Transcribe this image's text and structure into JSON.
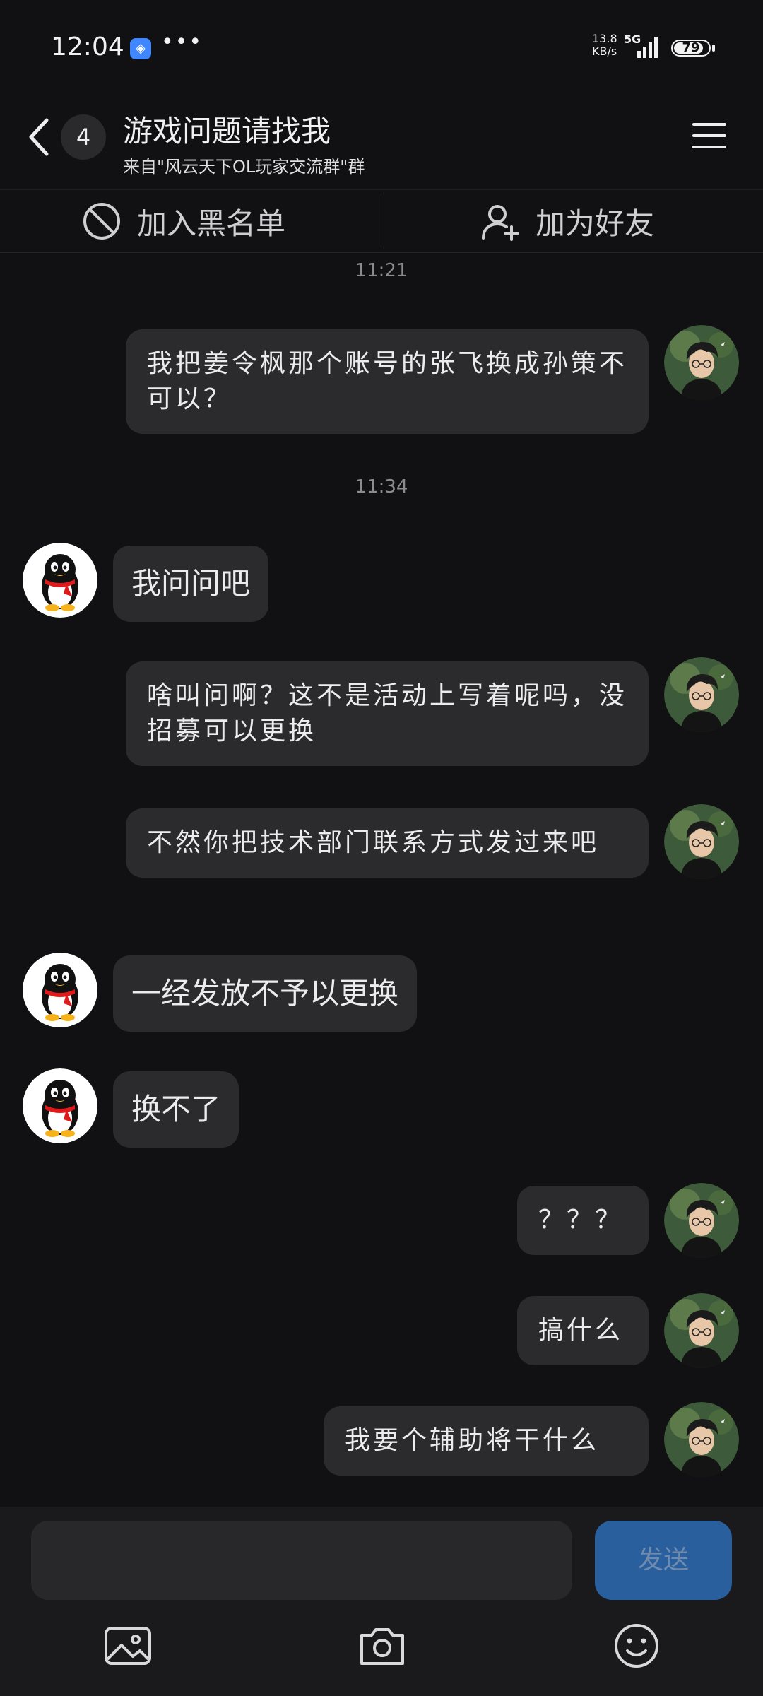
{
  "status_bar": {
    "time": "12:04",
    "more": "•••",
    "net_speed_value": "13.8",
    "net_speed_unit": "KB/s",
    "network_type": "5G",
    "battery": "79"
  },
  "header": {
    "unread_count": "4",
    "title": "游戏问题请找我",
    "subtitle": "来自\"风云天下OL玩家交流群\"群"
  },
  "actions": {
    "blacklist_label": "加入黑名单",
    "add_friend_label": "加为好友"
  },
  "messages": {
    "ts1": "11:21",
    "m1": {
      "text": "我把姜令枫那个账号的张飞换成孙策不可以？"
    },
    "ts2": "11:34",
    "m2": {
      "text": "我问问吧"
    },
    "m3": {
      "text": "啥叫问啊？这不是活动上写着呢吗，没招募可以更换"
    },
    "m4": {
      "text": "不然你把技术部门联系方式发过来吧"
    },
    "m5": {
      "text": "一经发放不予以更换"
    },
    "m6": {
      "text": "换不了"
    },
    "m7": {
      "text": "？？？"
    },
    "m8": {
      "text": "搞什么"
    },
    "m9": {
      "text": "我要个辅助将干什么"
    }
  },
  "composer": {
    "input_value": "",
    "send_label": "发送"
  },
  "icons": {
    "back": "chevron-left-icon",
    "menu": "hamburger-menu-icon",
    "blacklist": "ban-icon",
    "add_friend": "add-user-icon",
    "gallery": "image-icon",
    "camera": "camera-icon",
    "emoji": "smiley-icon"
  },
  "colors": {
    "background": "#111113",
    "bubble": "#2b2b2e",
    "send_button": "#2a5f9e"
  }
}
